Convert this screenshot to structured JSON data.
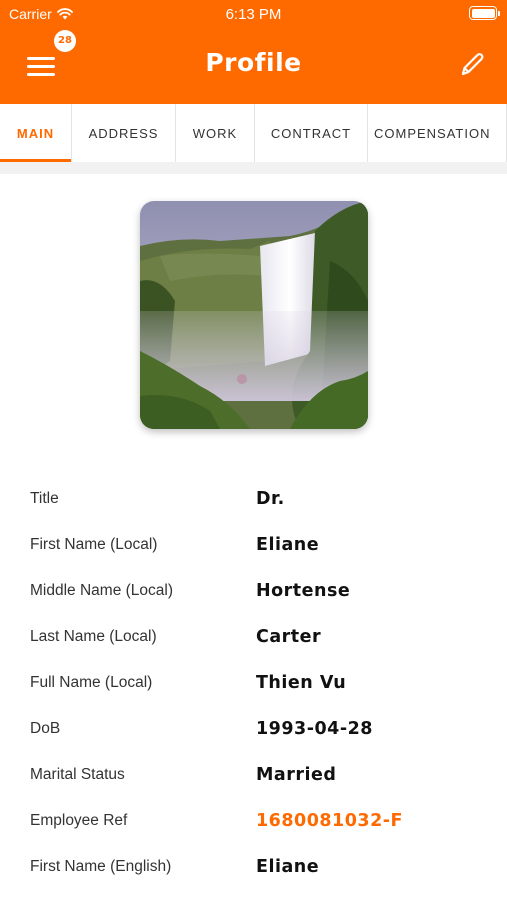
{
  "status_bar": {
    "carrier": "Carrier",
    "time": "6:13 PM",
    "battery_level": 1.0
  },
  "header": {
    "title": "Profile",
    "notification_count": "28",
    "accent_color": "#ff6a00"
  },
  "tabs": [
    {
      "label": "MAIN",
      "active": true
    },
    {
      "label": "ADDRESS",
      "active": false
    },
    {
      "label": "WORK",
      "active": false
    },
    {
      "label": "CONTRACT",
      "active": false
    },
    {
      "label": "COMPENSATION",
      "active": false
    }
  ],
  "profile_photo": {
    "icon": "waterfall-landscape-photo"
  },
  "fields": [
    {
      "label": "Title",
      "value": "Dr."
    },
    {
      "label": "First Name (Local)",
      "value": "Eliane"
    },
    {
      "label": "Middle Name (Local)",
      "value": "Hortense"
    },
    {
      "label": "Last Name (Local)",
      "value": "Carter"
    },
    {
      "label": "Full Name (Local)",
      "value": "Thien Vu"
    },
    {
      "label": "DoB",
      "value": "1993-04-28"
    },
    {
      "label": "Marital Status",
      "value": "Married"
    },
    {
      "label": "Employee Ref",
      "value": "1680081032-F"
    },
    {
      "label": "First Name (English)",
      "value": "Eliane"
    }
  ]
}
